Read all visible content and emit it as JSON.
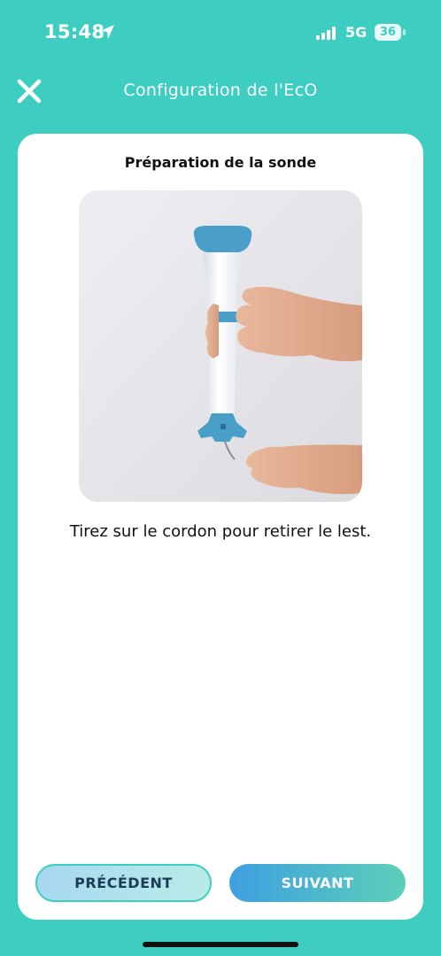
{
  "status_bar": {
    "time": "15:48",
    "network": "5G",
    "battery": "36"
  },
  "header": {
    "title": "Configuration de l'EcO",
    "close_icon": "close-icon"
  },
  "card": {
    "title": "Préparation de la sonde",
    "instruction": "Tirez sur le cordon pour retirer le lest."
  },
  "buttons": {
    "previous_label": "PRÉCÉDENT",
    "next_label": "SUIVANT"
  },
  "colors": {
    "background": "#3ecdc1",
    "probe_blue": "#4a9fc8",
    "next_gradient_start": "#3f9fe0",
    "next_gradient_end": "#5ccfb8"
  }
}
